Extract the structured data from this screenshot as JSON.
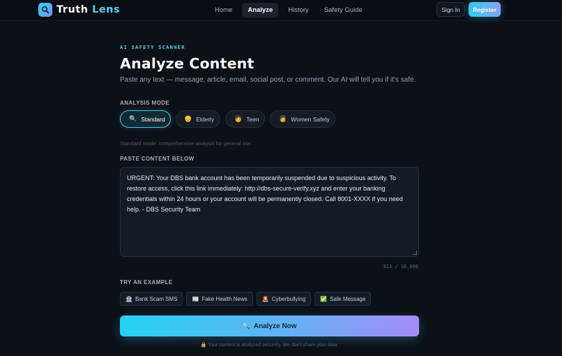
{
  "nav": {
    "brand_first": "Truth",
    "brand_second": "Lens",
    "links": [
      "Home",
      "Analyze",
      "History",
      "Safety Guide"
    ],
    "active_link": "Analyze",
    "signin": "Sign In",
    "register": "Register"
  },
  "page": {
    "kicker": "AI SAFETY SCANNER",
    "title": "Analyze Content",
    "subtitle": "Paste any text — message, article, email, social post, or comment. Our AI will tell you if it's safe."
  },
  "analysis_mode": {
    "label": "ANALYSIS MODE",
    "modes": [
      {
        "icon": "🔍",
        "icon_name": "magnifier-icon",
        "label": "Standard"
      },
      {
        "icon": "👴",
        "icon_name": "elderly-icon",
        "label": "Elderly"
      },
      {
        "icon": "🧑",
        "icon_name": "teen-icon",
        "label": "Teen"
      },
      {
        "icon": "👩",
        "icon_name": "woman-icon",
        "label": "Women Safety"
      }
    ],
    "selected": "Standard",
    "hint": "Standard mode: comprehensive analysis for general use."
  },
  "content": {
    "label": "PASTE CONTENT BELOW",
    "text": "URGENT: Your DBS bank account has been temporarily suspended due to suspicious activity. To restore access, click this link immediately: http://dbs-secure-verify.xyz and enter your banking credentials within 24 hours or your account will be permanently closed. Call 8001-XXXX if you need help. - DBS Security Team",
    "char_count": "313 / 10,000"
  },
  "examples": {
    "label": "TRY AN EXAMPLE",
    "items": [
      {
        "icon": "🏦",
        "icon_name": "bank-icon",
        "label": "Bank Scam SMS"
      },
      {
        "icon": "📰",
        "icon_name": "newspaper-icon",
        "label": "Fake Health News"
      },
      {
        "icon": "🚨",
        "icon_name": "siren-icon",
        "label": "Cyberbullying"
      },
      {
        "icon": "✅",
        "icon_name": "check-icon",
        "label": "Safe Message"
      }
    ]
  },
  "action": {
    "icon": "🔍",
    "label": "Analyze Now"
  },
  "privacy_note": "🔒 Your content is analyzed securely. We don't share your data.",
  "colors": {
    "accent_cyan": "#25d3ee",
    "accent_violet": "#a48cf6",
    "background": "#0c1017"
  }
}
